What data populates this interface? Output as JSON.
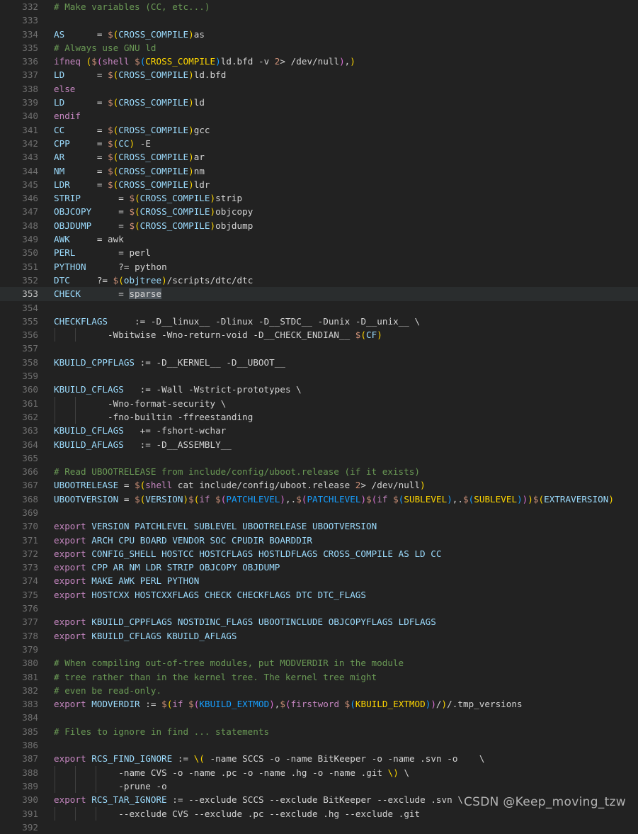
{
  "editor": {
    "first_line_number": 332,
    "active_line_number": 353,
    "selection_text": "sparse",
    "background_color": "#222222",
    "line_number_color": "#707070",
    "active_line_background": "#2a2d2e",
    "colors": {
      "comment": "#6A9955",
      "variable": "#9CDCFE",
      "keyword": "#C586C0",
      "dollar": "#CE9178",
      "paren_level1": "#FFD700",
      "paren_level2": "#DA70D6",
      "paren_level3": "#179FFF",
      "plain_text": "#d4d4d4",
      "selection": "#51585e",
      "indent_guide": "#404040"
    }
  },
  "watermark": {
    "text": "CSDN @Keep_moving_tzw"
  },
  "lines": [
    {
      "n": "332",
      "text": "# Make variables (CC, etc...)"
    },
    {
      "n": "333",
      "text": ""
    },
    {
      "n": "334",
      "text": "AS      = $(CROSS_COMPILE)as"
    },
    {
      "n": "335",
      "text": "# Always use GNU ld"
    },
    {
      "n": "336",
      "text": "ifneq ($(shell $(CROSS_COMPILE)ld.bfd -v 2> /dev/null),)"
    },
    {
      "n": "337",
      "text": "LD      = $(CROSS_COMPILE)ld.bfd"
    },
    {
      "n": "338",
      "text": "else"
    },
    {
      "n": "339",
      "text": "LD      = $(CROSS_COMPILE)ld"
    },
    {
      "n": "340",
      "text": "endif"
    },
    {
      "n": "341",
      "text": "CC      = $(CROSS_COMPILE)gcc"
    },
    {
      "n": "342",
      "text": "CPP     = $(CC) -E"
    },
    {
      "n": "343",
      "text": "AR      = $(CROSS_COMPILE)ar"
    },
    {
      "n": "344",
      "text": "NM      = $(CROSS_COMPILE)nm"
    },
    {
      "n": "345",
      "text": "LDR     = $(CROSS_COMPILE)ldr"
    },
    {
      "n": "346",
      "text": "STRIP       = $(CROSS_COMPILE)strip"
    },
    {
      "n": "347",
      "text": "OBJCOPY     = $(CROSS_COMPILE)objcopy"
    },
    {
      "n": "348",
      "text": "OBJDUMP     = $(CROSS_COMPILE)objdump"
    },
    {
      "n": "349",
      "text": "AWK     = awk"
    },
    {
      "n": "350",
      "text": "PERL        = perl"
    },
    {
      "n": "351",
      "text": "PYTHON      ?= python"
    },
    {
      "n": "352",
      "text": "DTC     ?= $(objtree)/scripts/dtc/dtc"
    },
    {
      "n": "353",
      "text": "CHECK       = sparse"
    },
    {
      "n": "354",
      "text": ""
    },
    {
      "n": "355",
      "text": "CHECKFLAGS     := -D__linux__ -Dlinux -D__STDC__ -Dunix -D__unix__ \\"
    },
    {
      "n": "356",
      "text": "          -Wbitwise -Wno-return-void -D__CHECK_ENDIAN__ $(CF)"
    },
    {
      "n": "357",
      "text": ""
    },
    {
      "n": "358",
      "text": "KBUILD_CPPFLAGS := -D__KERNEL__ -D__UBOOT__"
    },
    {
      "n": "359",
      "text": ""
    },
    {
      "n": "360",
      "text": "KBUILD_CFLAGS   := -Wall -Wstrict-prototypes \\"
    },
    {
      "n": "361",
      "text": "          -Wno-format-security \\"
    },
    {
      "n": "362",
      "text": "          -fno-builtin -ffreestanding"
    },
    {
      "n": "363",
      "text": "KBUILD_CFLAGS   += -fshort-wchar"
    },
    {
      "n": "364",
      "text": "KBUILD_AFLAGS   := -D__ASSEMBLY__"
    },
    {
      "n": "365",
      "text": ""
    },
    {
      "n": "366",
      "text": "# Read UBOOTRELEASE from include/config/uboot.release (if it exists)"
    },
    {
      "n": "367",
      "text": "UBOOTRELEASE = $(shell cat include/config/uboot.release 2> /dev/null)"
    },
    {
      "n": "368",
      "text": "UBOOTVERSION = $(VERSION)$(if $(PATCHLEVEL),.$(PATCHLEVEL)$(if $(SUBLEVEL),.$(SUBLEVEL)))$(EXTRAVERSION)"
    },
    {
      "n": "369",
      "text": ""
    },
    {
      "n": "370",
      "text": "export VERSION PATCHLEVEL SUBLEVEL UBOOTRELEASE UBOOTVERSION"
    },
    {
      "n": "371",
      "text": "export ARCH CPU BOARD VENDOR SOC CPUDIR BOARDDIR"
    },
    {
      "n": "372",
      "text": "export CONFIG_SHELL HOSTCC HOSTCFLAGS HOSTLDFLAGS CROSS_COMPILE AS LD CC"
    },
    {
      "n": "373",
      "text": "export CPP AR NM LDR STRIP OBJCOPY OBJDUMP"
    },
    {
      "n": "374",
      "text": "export MAKE AWK PERL PYTHON"
    },
    {
      "n": "375",
      "text": "export HOSTCXX HOSTCXXFLAGS CHECK CHECKFLAGS DTC DTC_FLAGS"
    },
    {
      "n": "376",
      "text": ""
    },
    {
      "n": "377",
      "text": "export KBUILD_CPPFLAGS NOSTDINC_FLAGS UBOOTINCLUDE OBJCOPYFLAGS LDFLAGS"
    },
    {
      "n": "378",
      "text": "export KBUILD_CFLAGS KBUILD_AFLAGS"
    },
    {
      "n": "379",
      "text": ""
    },
    {
      "n": "380",
      "text": "# When compiling out-of-tree modules, put MODVERDIR in the module"
    },
    {
      "n": "381",
      "text": "# tree rather than in the kernel tree. The kernel tree might"
    },
    {
      "n": "382",
      "text": "# even be read-only."
    },
    {
      "n": "383",
      "text": "export MODVERDIR := $(if $(KBUILD_EXTMOD),$(firstword $(KBUILD_EXTMOD))/)/.tmp_versions"
    },
    {
      "n": "384",
      "text": ""
    },
    {
      "n": "385",
      "text": "# Files to ignore in find ... statements"
    },
    {
      "n": "386",
      "text": ""
    },
    {
      "n": "387",
      "text": "export RCS_FIND_IGNORE := \\( -name SCCS -o -name BitKeeper -o -name .svn -o    \\"
    },
    {
      "n": "388",
      "text": "            -name CVS -o -name .pc -o -name .hg -o -name .git \\) \\"
    },
    {
      "n": "389",
      "text": "            -prune -o"
    },
    {
      "n": "390",
      "text": "export RCS_TAR_IGNORE := --exclude SCCS --exclude BitKeeper --exclude .svn \\"
    },
    {
      "n": "391",
      "text": "            --exclude CVS --exclude .pc --exclude .hg --exclude .git"
    },
    {
      "n": "392",
      "text": ""
    }
  ]
}
